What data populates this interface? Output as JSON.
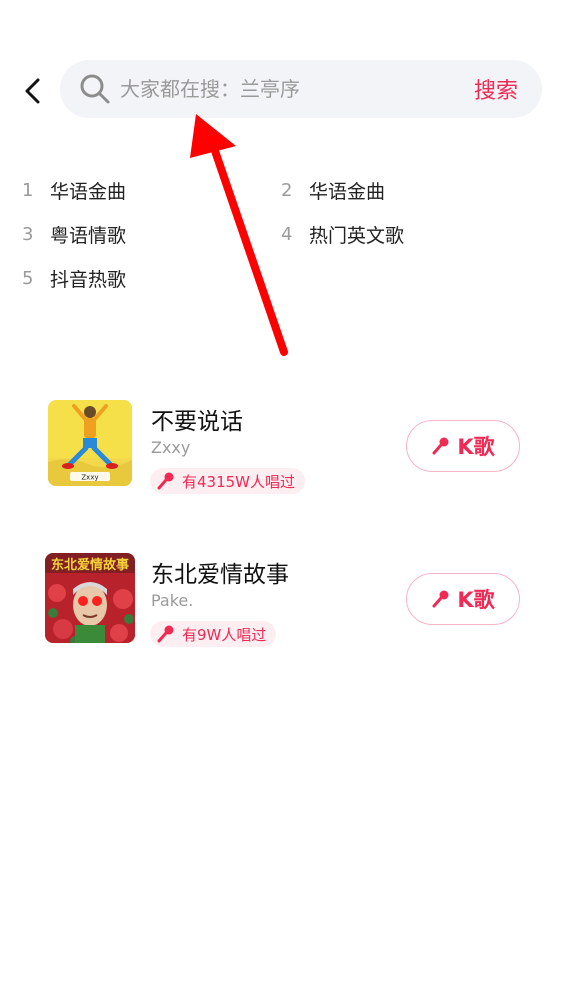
{
  "header": {
    "back_icon": "chevron-left-icon",
    "search_placeholder": "大家都在搜：兰亭序",
    "search_button": "搜索"
  },
  "hot_terms": [
    {
      "rank": "1",
      "label": "华语金曲"
    },
    {
      "rank": "2",
      "label": "华语金曲"
    },
    {
      "rank": "3",
      "label": "粤语情歌"
    },
    {
      "rank": "4",
      "label": "热门英文歌"
    },
    {
      "rank": "5",
      "label": "抖音热歌"
    }
  ],
  "songs": [
    {
      "title": "不要说话",
      "artist": "Zxxy",
      "sung_count": "有4315W人唱过",
      "k_button": "K歌",
      "cover_caption": "Zxxy"
    },
    {
      "title": "东北爱情故事",
      "artist": "Pake.",
      "sung_count": "有9W人唱过",
      "k_button": "K歌",
      "cover_caption": "东北爱情故事"
    }
  ],
  "colors": {
    "accent": "#ef2a55",
    "badge_bg": "#fdeef2",
    "search_bg": "#f3f4f7",
    "annotation_arrow": "#ff0000"
  }
}
